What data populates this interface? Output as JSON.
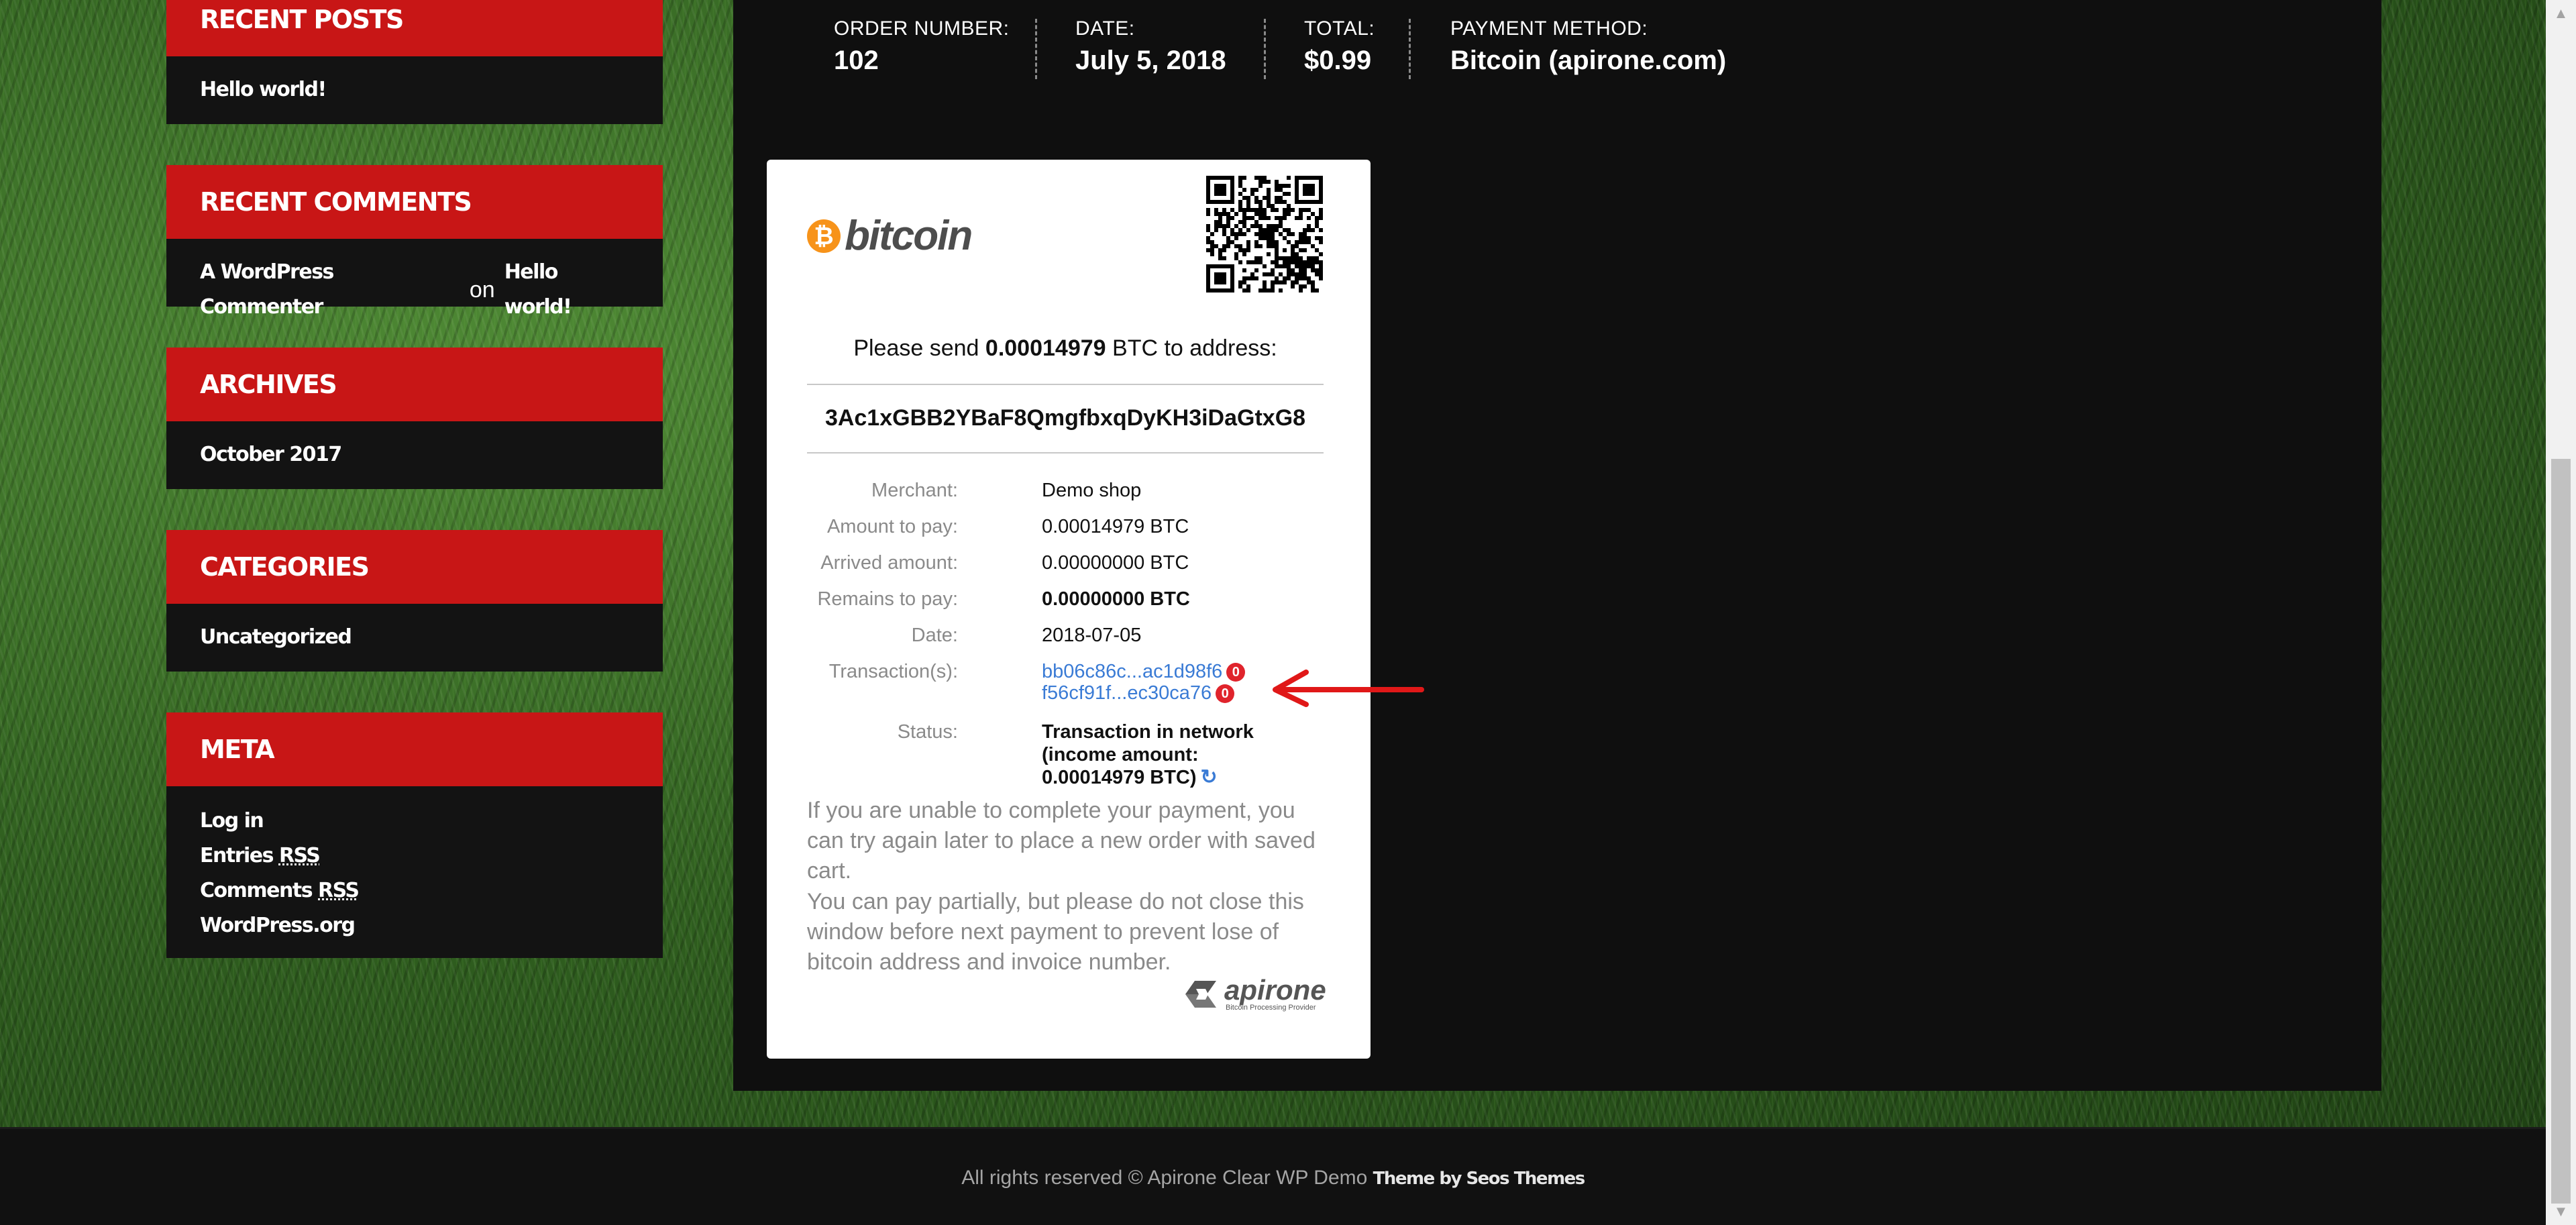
{
  "sidebar": {
    "recent_posts": {
      "title": "RECENT POSTS",
      "items": [
        "Hello world!"
      ]
    },
    "recent_comments": {
      "title": "RECENT COMMENTS",
      "author": "A WordPress Commenter",
      "on_word": "on",
      "post": "Hello world!"
    },
    "archives": {
      "title": "ARCHIVES",
      "items": [
        "October 2017"
      ]
    },
    "categories": {
      "title": "CATEGORIES",
      "items": [
        "Uncategorized"
      ]
    },
    "meta": {
      "title": "META",
      "log_in": "Log in",
      "entries": "Entries",
      "comments": "Comments",
      "rss": "RSS",
      "wordpress_org": "WordPress.org"
    }
  },
  "order": {
    "number_label": "ORDER NUMBER:",
    "number": "102",
    "date_label": "DATE:",
    "date": "July 5, 2018",
    "total_label": "TOTAL:",
    "total": "$0.99",
    "method_label": "PAYMENT METHOD:",
    "method": "Bitcoin (apirone.com)"
  },
  "invoice": {
    "logo_symbol": "₿",
    "logo_word": "bitcoin",
    "send_prefix": "Please send",
    "send_amount": "0.00014979",
    "send_suffix": "BTC to address:",
    "address": "3Ac1xGBB2YBaF8QmgfbxqDyKH3iDaGtxG8",
    "merchant_label": "Merchant:",
    "merchant": "Demo shop",
    "amount_label": "Amount to pay:",
    "amount": "0.00014979 BTC",
    "arrived_label": "Arrived amount:",
    "arrived": "0.00000000 BTC",
    "remains_label": "Remains to pay:",
    "remains": "0.00000000 BTC",
    "date_label": "Date:",
    "date": "2018-07-05",
    "tx_label": "Transaction(s):",
    "transactions": [
      {
        "hash": "bb06c86c...ac1d98f6",
        "confirmations": "0"
      },
      {
        "hash": "f56cf91f...ec30ca76",
        "confirmations": "0"
      }
    ],
    "status_label": "Status:",
    "status_line1": "Transaction in network",
    "status_line2": "(income amount:",
    "status_line3": "0.00014979 BTC)",
    "note1": "If you are unable to complete your payment, you can try again later to place a new order with saved cart.",
    "note2": "You can pay partially, but please do not close this window before next payment to prevent lose of bitcoin address and invoice number.",
    "provider_name": "apirone",
    "provider_tagline": "Bitcoin Processing Provider"
  },
  "footer": {
    "rights": "All rights reserved © Apirone Clear WP Demo",
    "theme": "Theme by Seos Themes"
  },
  "colors": {
    "accent_red": "#c81616",
    "bitcoin_orange": "#f7931a",
    "link_blue": "#3a7bd5",
    "badge_red": "#e0242c"
  }
}
